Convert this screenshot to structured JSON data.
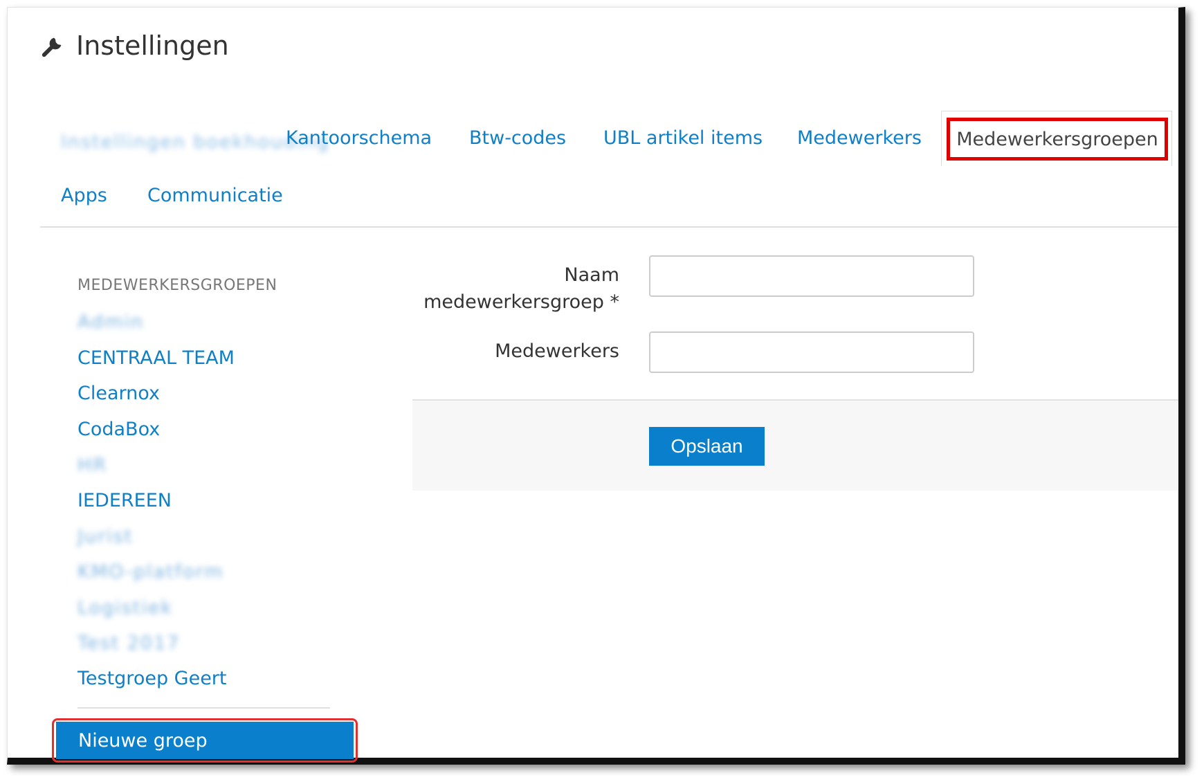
{
  "page": {
    "title": "Instellingen",
    "title_icon": "wrench-icon"
  },
  "tabs": [
    {
      "label": "Instellingen boekhouding",
      "blurred": true
    },
    {
      "label": "Kantoorschema"
    },
    {
      "label": "Btw-codes"
    },
    {
      "label": "UBL artikel items"
    },
    {
      "label": "Medewerkers"
    },
    {
      "label": "Medewerkersgroepen",
      "active": true
    },
    {
      "label": "Apps"
    },
    {
      "label": "Communicatie"
    }
  ],
  "sidebar": {
    "heading": "MEDEWERKERSGROEPEN",
    "groups": [
      {
        "label": "Admin",
        "blurred": true
      },
      {
        "label": "CENTRAAL TEAM"
      },
      {
        "label": "Clearnox"
      },
      {
        "label": "CodaBox"
      },
      {
        "label": "HR",
        "blurred": true
      },
      {
        "label": "IEDEREEN"
      },
      {
        "label": "Jurist",
        "blurred": true
      },
      {
        "label": "KMO-platform",
        "blurred": true
      },
      {
        "label": "Logistiek",
        "blurred": true
      },
      {
        "label": "Test 2017",
        "blurred": true
      },
      {
        "label": "Testgroep Geert"
      }
    ],
    "new_group_label": "Nieuwe groep"
  },
  "form": {
    "name_label_line1": "Naam",
    "name_label_line2": "medewerkersgroep *",
    "name_value": "",
    "members_label": "Medewerkers",
    "members_value": "",
    "save_label": "Opslaan"
  },
  "colors": {
    "link": "#0f7fc8",
    "primary_button": "#0a7fcc",
    "highlight": "#e00000"
  }
}
